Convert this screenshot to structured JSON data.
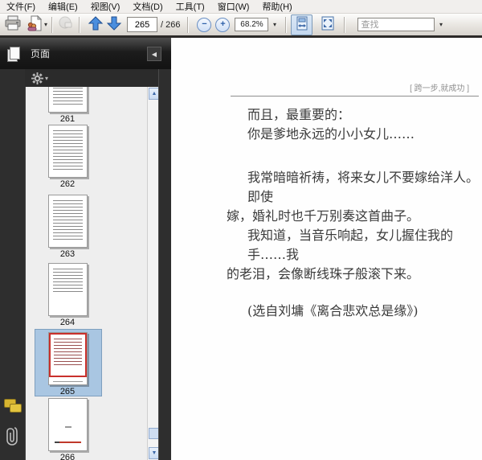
{
  "menubar": {
    "items": [
      "文件(F)",
      "编辑(E)",
      "视图(V)",
      "文档(D)",
      "工具(T)",
      "窗口(W)",
      "帮助(H)"
    ]
  },
  "toolbar": {
    "page_current": "265",
    "page_total_label": "/ 266",
    "zoom_level": "68.2%",
    "find_placeholder": "查找",
    "icons": {
      "print-icon": "printer glyph",
      "collaborate-icon": "page with people dots",
      "share-disabled-icon": "grayed spheres",
      "prev-page-icon": "blue up arrow",
      "next-page-icon": "blue down arrow",
      "zoom-out-icon": "−",
      "zoom-in-icon": "+",
      "scroll-mode-icon": "page with horizontal arrows",
      "fit-page-icon": "page with outward arrows",
      "dropdown-caret-icon": "▾"
    }
  },
  "sidebar": {
    "panel_title": "页面",
    "icons": {
      "pages-panel-icon": "stacked pages",
      "options-gear-icon": "⚙",
      "collapse-panel-icon": "◂",
      "comments-icon": "yellow speech bubbles",
      "attachments-icon": "paperclip",
      "scroll-up-icon": "▲",
      "scroll-down-icon": "▼"
    },
    "thumbnails": [
      {
        "page": "261",
        "selected": false
      },
      {
        "page": "262",
        "selected": false
      },
      {
        "page": "263",
        "selected": false
      },
      {
        "page": "264",
        "selected": false
      },
      {
        "page": "265",
        "selected": true
      },
      {
        "page": "266",
        "selected": false
      }
    ]
  },
  "document": {
    "header_title": "[ 跨一步,就成功 ]",
    "lines": [
      "而且，最重要的：",
      "你是爹地永远的小小女儿……",
      "我常暗暗祈祷，将来女儿不要嫁给洋人。即使",
      "嫁，婚礼时也千万别奏这首曲子。",
      "我知道，当音乐响起，女儿握住我的手……我",
      "的老泪，会像断线珠子般滚下来。",
      "(选自刘墉《离合悲欢总是缘》)"
    ]
  },
  "colors": {
    "selection_blue": "#a9c6e2",
    "view_indicator_red": "#c9302c",
    "sidebar_dark": "#2e2e2e",
    "toolbar_gray": "#e3e0db",
    "accent_blue": "#3f7fd4"
  }
}
